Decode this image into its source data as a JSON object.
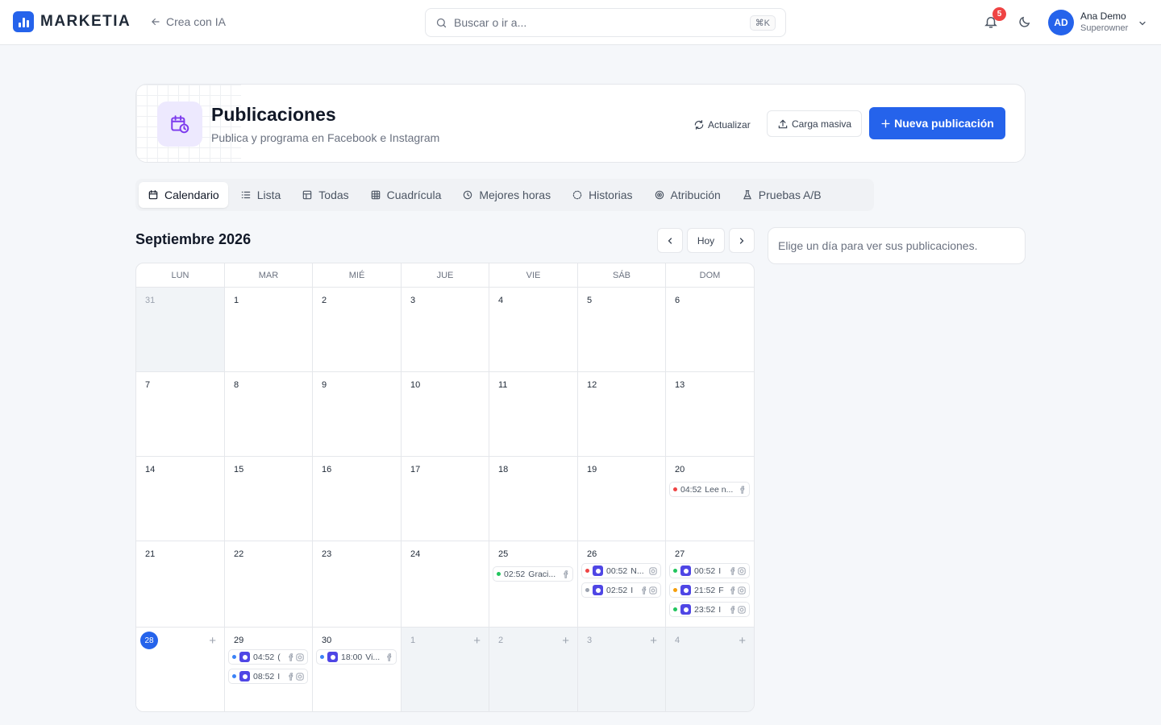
{
  "topbar": {
    "brand": "MARKETIA",
    "back_label": "Crea con IA",
    "search_placeholder": "Buscar o ir a...",
    "search_shortcut": "⌘K",
    "notif_count": "5",
    "user_initials": "AD",
    "user_name": "Ana Demo",
    "user_role": "Superowner"
  },
  "header": {
    "title": "Publicaciones",
    "subtitle": "Publica y programa en Facebook e Instagram",
    "refresh_label": "Actualizar",
    "bulk_label": "Carga masiva",
    "new_label": "Nueva publicación"
  },
  "tabs": [
    {
      "label": "Calendario",
      "icon": "calendar-icon",
      "active": true
    },
    {
      "label": "Lista",
      "icon": "list-icon"
    },
    {
      "label": "Todas",
      "icon": "table-icon"
    },
    {
      "label": "Cuadrícula",
      "icon": "grid-icon"
    },
    {
      "label": "Mejores horas",
      "icon": "clock-icon"
    },
    {
      "label": "Historias",
      "icon": "stories-icon"
    },
    {
      "label": "Atribución",
      "icon": "target-icon"
    },
    {
      "label": "Pruebas A/B",
      "icon": "flask-icon"
    }
  ],
  "calendar": {
    "month_title": "Septiembre 2026",
    "today_label": "Hoy",
    "weekdays": [
      "LUN",
      "MAR",
      "MIÉ",
      "JUE",
      "VIE",
      "SÁB",
      "DOM"
    ],
    "weeks": [
      [
        {
          "d": "31",
          "out": true
        },
        {
          "d": "1"
        },
        {
          "d": "2"
        },
        {
          "d": "3"
        },
        {
          "d": "4"
        },
        {
          "d": "5"
        },
        {
          "d": "6"
        }
      ],
      [
        {
          "d": "7"
        },
        {
          "d": "8"
        },
        {
          "d": "9"
        },
        {
          "d": "10"
        },
        {
          "d": "11"
        },
        {
          "d": "12"
        },
        {
          "d": "13"
        }
      ],
      [
        {
          "d": "14"
        },
        {
          "d": "15"
        },
        {
          "d": "16"
        },
        {
          "d": "17"
        },
        {
          "d": "18"
        },
        {
          "d": "19"
        },
        {
          "d": "20",
          "posts": [
            {
              "time": "04:52",
              "text": "Lee n...",
              "color": "#ef4444",
              "avatar": false,
              "fb": true,
              "ig": false
            }
          ]
        }
      ],
      [
        {
          "d": "21"
        },
        {
          "d": "22"
        },
        {
          "d": "23"
        },
        {
          "d": "24"
        },
        {
          "d": "25",
          "posts": [
            {
              "time": "02:52",
              "text": "Graci...",
              "color": "#22c55e",
              "avatar": false,
              "fb": true,
              "ig": false
            }
          ]
        },
        {
          "d": "26",
          "posts": [
            {
              "time": "00:52",
              "text": "N...",
              "color": "#ef4444",
              "avatar": true,
              "fb": false,
              "ig": true
            },
            {
              "time": "02:52",
              "text": "I",
              "color": "#9ca3af",
              "avatar": true,
              "fb": true,
              "ig": true
            }
          ]
        },
        {
          "d": "27",
          "posts": [
            {
              "time": "00:52",
              "text": "I",
              "color": "#22c55e",
              "avatar": true,
              "fb": true,
              "ig": true
            },
            {
              "time": "21:52",
              "text": "F",
              "color": "#f59e0b",
              "avatar": true,
              "fb": true,
              "ig": true
            },
            {
              "time": "23:52",
              "text": "I",
              "color": "#22c55e",
              "avatar": true,
              "fb": true,
              "ig": true
            }
          ]
        }
      ],
      [
        {
          "d": "28",
          "today": true,
          "plus": true
        },
        {
          "d": "29",
          "posts": [
            {
              "time": "04:52",
              "text": "(",
              "color": "#3b82f6",
              "avatar": true,
              "fb": true,
              "ig": true
            },
            {
              "time": "08:52",
              "text": "I",
              "color": "#3b82f6",
              "avatar": true,
              "fb": true,
              "ig": true
            }
          ]
        },
        {
          "d": "30",
          "posts": [
            {
              "time": "18:00",
              "text": "Vi...",
              "color": "#3b82f6",
              "avatar": true,
              "fb": true,
              "ig": false
            }
          ]
        },
        {
          "d": "1",
          "out": true,
          "plus": true
        },
        {
          "d": "2",
          "out": true,
          "plus": true
        },
        {
          "d": "3",
          "out": true,
          "plus": true
        },
        {
          "d": "4",
          "out": true,
          "plus": true
        }
      ]
    ]
  },
  "side_panel": {
    "hint": "Elige un día para ver sus publicaciones."
  },
  "colors": {
    "primary": "#2563eb",
    "icon_tile": "#ede9fe"
  }
}
